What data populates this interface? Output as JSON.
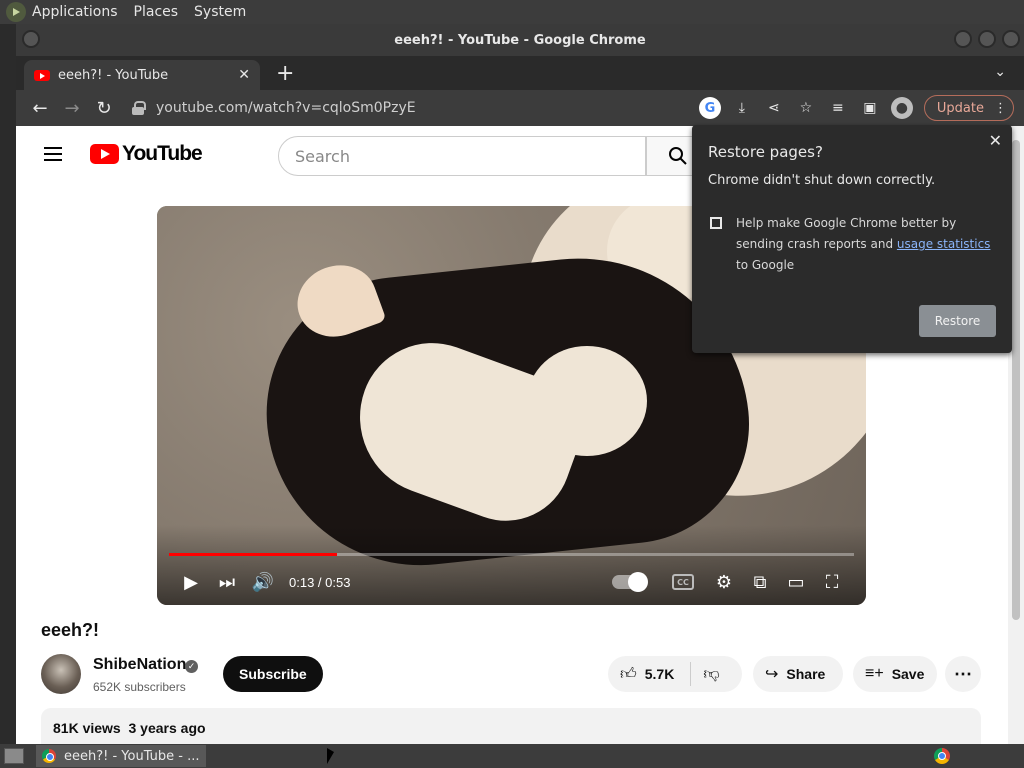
{
  "top_panel": {
    "menus": [
      "Applications",
      "Places",
      "System"
    ]
  },
  "window": {
    "title": "eeeh?! - YouTube - Google Chrome"
  },
  "tabs": [
    {
      "label": "eeeh?! - YouTube"
    }
  ],
  "omnibox": {
    "url": "youtube.com/watch?v=cqloSm0PzyE"
  },
  "toolbar": {
    "update_label": "Update"
  },
  "youtube": {
    "logo_text": "YouTube",
    "search_placeholder": "Search",
    "player": {
      "time": "0:13 / 0:53",
      "progress": 0.245
    },
    "video_title": "eeeh?!",
    "channel_name": "ShibeNation",
    "subscribers": "652K subscribers",
    "subscribe_label": "Subscribe",
    "likes": "5.7K",
    "share_label": "Share",
    "save_label": "Save",
    "views": "81K views",
    "posted": "3 years ago"
  },
  "restore_popup": {
    "title": "Restore pages?",
    "message": "Chrome didn't shut down correctly.",
    "help_prefix": "Help make Google Chrome better by sending crash reports and ",
    "help_link": "usage statistics",
    "help_suffix": " to Google",
    "restore_label": "Restore"
  },
  "taskbar": {
    "window_label": "eeeh?! - YouTube - ..."
  },
  "colors": {
    "youtube_red": "#ff0000",
    "update_accent": "#b56d5b",
    "link_blue": "#8ab4f8"
  }
}
